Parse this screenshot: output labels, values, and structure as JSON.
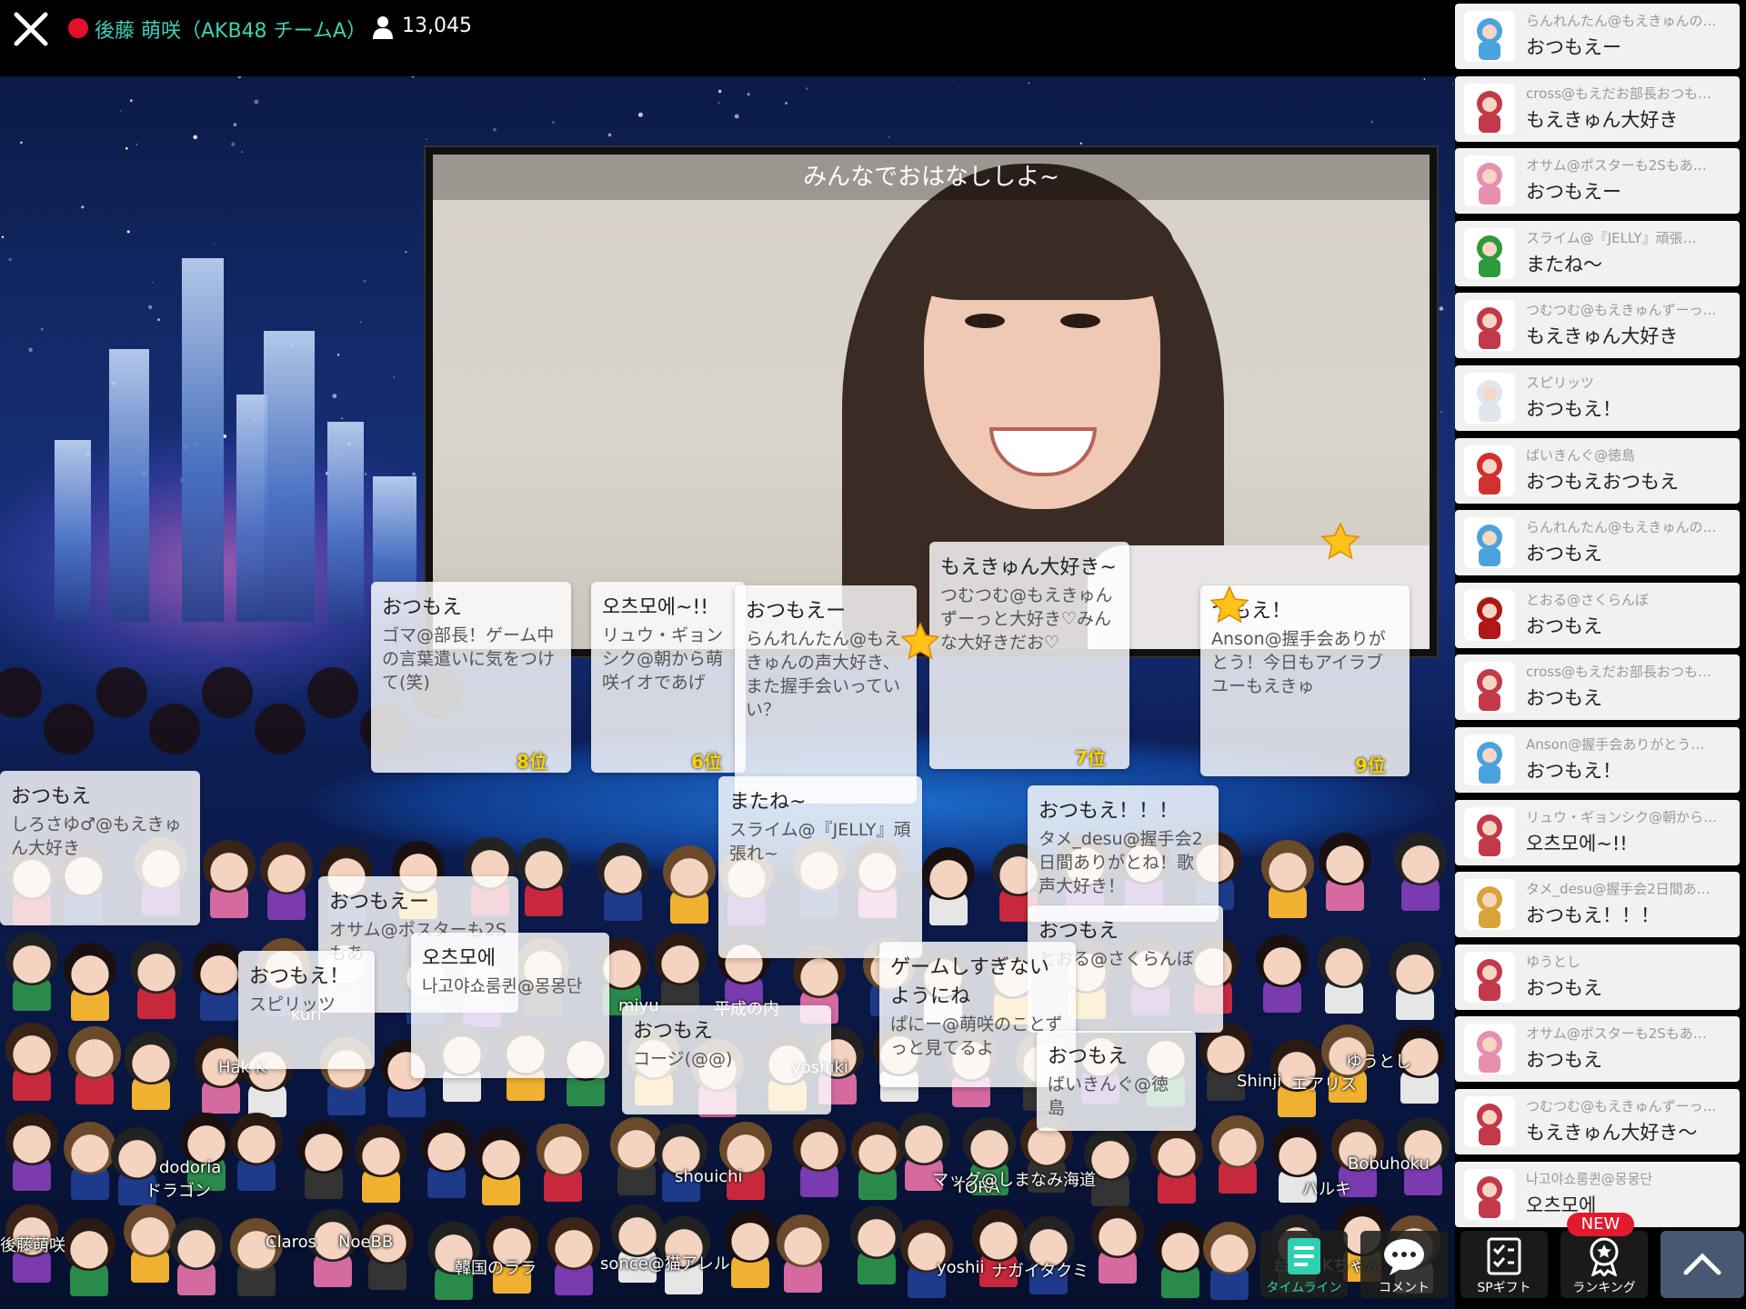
{
  "header": {
    "performer": "後藤 萌咲（AKB48 チームA）",
    "viewer_count": "13,045"
  },
  "video": {
    "caption": "みんなでおはなししよ~"
  },
  "stage_comments": [
    {
      "title": "おつもえ",
      "text": "ゴマ@部長！ゲーム中の言葉遣いに気をつけて(笑)",
      "rank": "8位"
    },
    {
      "title": "오츠모에~!!",
      "text": "リュウ・ギョンシク@朝から萌咲イオであげ",
      "rank": "6位"
    },
    {
      "title": "おつもえー",
      "text": "らんれんたん@もえきゅんの声大好き、また握手会いっていい？",
      "rank": ""
    },
    {
      "title": "もえきゅん大好き~",
      "text": "つむつむ@もえきゅんずーっと大好き♡みんな大好きだお♡",
      "rank": "7位"
    },
    {
      "title": "つもえ！",
      "text": "Anson@握手会ありがとう！今日もアイラブユーもえきゅ",
      "rank": "9位"
    },
    {
      "title": "またね~",
      "text": "スライム@『JELLY』頑張れ~",
      "rank": ""
    },
    {
      "title": "おつもえ！！！",
      "text": "タメ_desu@握手会2日間ありがとね！歌声大好き！",
      "rank": ""
    },
    {
      "title": "おつもえー",
      "text": "オサム@ポスターも2Sもあ",
      "rank": ""
    },
    {
      "title": "오츠모에",
      "text": "나고야쇼룸퀸@몽몽단",
      "rank": ""
    },
    {
      "title": "おつもえ！",
      "text": "スピリッツ",
      "rank": ""
    },
    {
      "title": "おつもえ",
      "text": "とおる@さくらんぼ",
      "rank": ""
    },
    {
      "title": "ゲームしすぎないようにね",
      "text": "ぱにー@萌咲のことずっと見てるよ",
      "rank": ""
    },
    {
      "title": "おつもえ",
      "text": "コージ(@@)",
      "rank": ""
    },
    {
      "title": "おつもえ",
      "text": "ばいきんぐ@徳島",
      "rank": ""
    },
    {
      "title": "おつもえ",
      "text": "しろさゆ♂@もえきゅん大好き",
      "rank": ""
    }
  ],
  "crowd_names": [
    "後藤萌咲",
    "dodoria",
    "ドラゴン",
    "Claros",
    "NoeBB",
    "韓国のララ",
    "sonce@猫アレル",
    "shouichi",
    "TORA",
    "yoshii",
    "ナガイタクミ",
    "Shinji",
    "エアリス",
    "ゆうとし",
    "yoshiki",
    "平成の内",
    "miyu",
    "kuri",
    "Hak K",
    "マッグ@しまなみ海道",
    "Bobuhoku",
    "ハルキ",
    "台湾のKちゃん"
  ],
  "comments": [
    {
      "user": "らんれんたん@もえきゅんの…",
      "message": "おつもえー",
      "avatar_color": "#4aa3df"
    },
    {
      "user": "cross@もえだお部長おつも…",
      "message": "もえきゅん大好き",
      "avatar_color": "#c23a4a"
    },
    {
      "user": "オサム@ポスターも2Sもあ…",
      "message": "おつもえー",
      "avatar_color": "#e88fb0"
    },
    {
      "user": "スライム@『JELLY』頑張…",
      "message": "またね～",
      "avatar_color": "#2e9a3a"
    },
    {
      "user": "つむつむ@もえきゅんずーっ…",
      "message": "もえきゅん大好き",
      "avatar_color": "#c23a4a"
    },
    {
      "user": "スピリッツ",
      "message": "おつもえ！",
      "avatar_color": "#dfe6ee"
    },
    {
      "user": "ばいきんぐ@徳島",
      "message": "おつもえおつもえ",
      "avatar_color": "#d23030"
    },
    {
      "user": "らんれんたん@もえきゅんの…",
      "message": "おつもえ",
      "avatar_color": "#4aa3df"
    },
    {
      "user": "とおる@さくらんぼ",
      "message": "おつもえ",
      "avatar_color": "#b01818"
    },
    {
      "user": "cross@もえだお部長おつも…",
      "message": "おつもえ",
      "avatar_color": "#c23a4a"
    },
    {
      "user": "Anson@握手会ありがとう…",
      "message": "おつもえ！",
      "avatar_color": "#4aa3df"
    },
    {
      "user": "リュウ・ギョンシク@朝から…",
      "message": "오츠모에~!!",
      "avatar_color": "#c23a4a"
    },
    {
      "user": "タメ_desu@握手会2日間あ…",
      "message": "おつもえ！！！",
      "avatar_color": "#d9a33a"
    },
    {
      "user": "ゆうとし",
      "message": "おつもえ",
      "avatar_color": "#c23a4a"
    },
    {
      "user": "オサム@ポスターも2Sもあ…",
      "message": "おつもえ",
      "avatar_color": "#e88fb0"
    },
    {
      "user": "つむつむ@もえきゅんずーっ…",
      "message": "もえきゅん大好き～",
      "avatar_color": "#c23a4a"
    },
    {
      "user": "나고야쇼룸퀸@몽몽단",
      "message": "오츠모에",
      "avatar_color": "#c23a4a"
    }
  ],
  "nav": {
    "timeline": "タイムライン",
    "comment": "コメント",
    "sp_gift": "SPギフト",
    "ranking": "ランキング",
    "new_badge": "NEW"
  },
  "colors": {
    "live": "#e3102a",
    "performer_text": "#3ed0b6",
    "timeline_icon": "#2fd0b0",
    "new_badge": "#e31a2e"
  }
}
